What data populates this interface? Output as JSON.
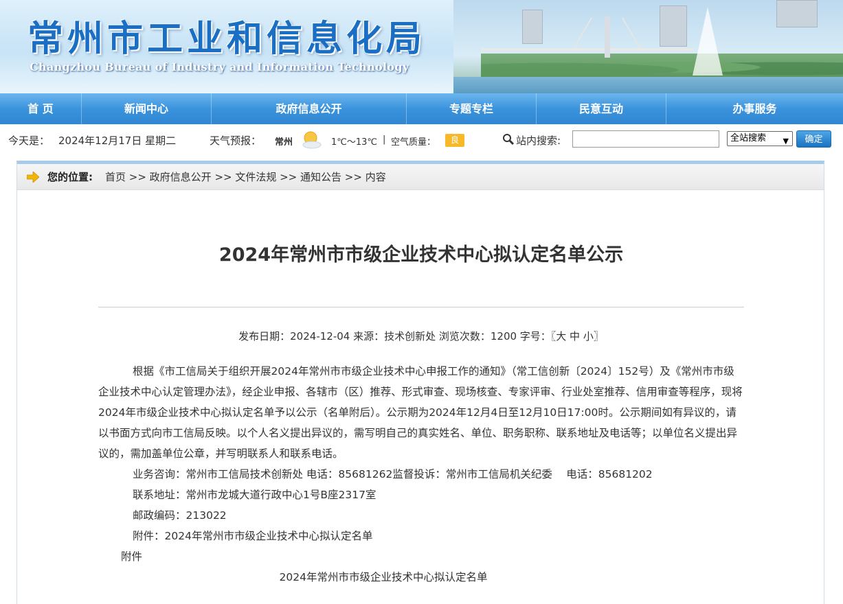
{
  "header": {
    "title_cn": "常州市工业和信息化局",
    "title_en": "Changzhou Bureau of Industry and Information Technology"
  },
  "nav": {
    "items": [
      {
        "label": "首 页"
      },
      {
        "label": "新闻中心"
      },
      {
        "label": "政府信息公开"
      },
      {
        "label": "专题专栏"
      },
      {
        "label": "民意互动"
      },
      {
        "label": "办事服务"
      }
    ]
  },
  "infobar": {
    "date_label": "今天是：",
    "date_value": "2024年12月17日 星期二",
    "weather_label": "天气预报：",
    "city": "常州",
    "temperature": "1℃～13℃",
    "separator": "|",
    "air_label": "空气质量：",
    "air_value": "良",
    "search_label": "站内搜索:",
    "search_value": "",
    "search_scope": "全站搜索",
    "search_button": "确定",
    "weather_icon": "sun-cloud-icon",
    "air_badge_color": "#f7b928"
  },
  "breadcrumb": {
    "label": "您的位置:",
    "path": "首页 >> 政府信息公开 >> 文件法规 >> 通知公告 >> 内容"
  },
  "article": {
    "title": "2024年常州市市级企业技术中心拟认定名单公示",
    "meta": "发布日期：2024-12-04  来源：技术创新处  浏览次数：1200  字号：〖大 中 小〗",
    "paragraph1": "根据《市工信局关于组织开展2024年常州市市级企业技术中心申报工作的通知》（常工信创新〔2024〕152号）及《常州市市级企业技术中心认定管理办法》，经企业申报、各辖市（区）推荐、形式审查、现场核查、专家评审、行业处室推荐、信用审查等程序，现将2024年市级企业技术中心拟认定名单予以公示（名单附后）。公示期为2024年12月4日至12月10日17:00时。公示期间如有异议的，请以书面方式向市工信局反映。以个人名义提出异议的，需写明自己的真实姓名、单位、职务职称、联系地址及电话等；以单位名义提出异议的，需加盖单位公章，并写明联系人和联系电话。",
    "consult": "业务咨询：常州市工信局技术创新处 电话：85681262监督投诉：常州市工信局机关纪委　 电话：85681202",
    "address": "联系地址：常州市龙城大道行政中心1号B座2317室",
    "postcode": "邮政编码：213022",
    "attachment": "附件：2024年常州市市级企业技术中心拟认定名单",
    "attachment_heading": "附件",
    "list_title": "2024年常州市市级企业技术中心拟认定名单"
  }
}
